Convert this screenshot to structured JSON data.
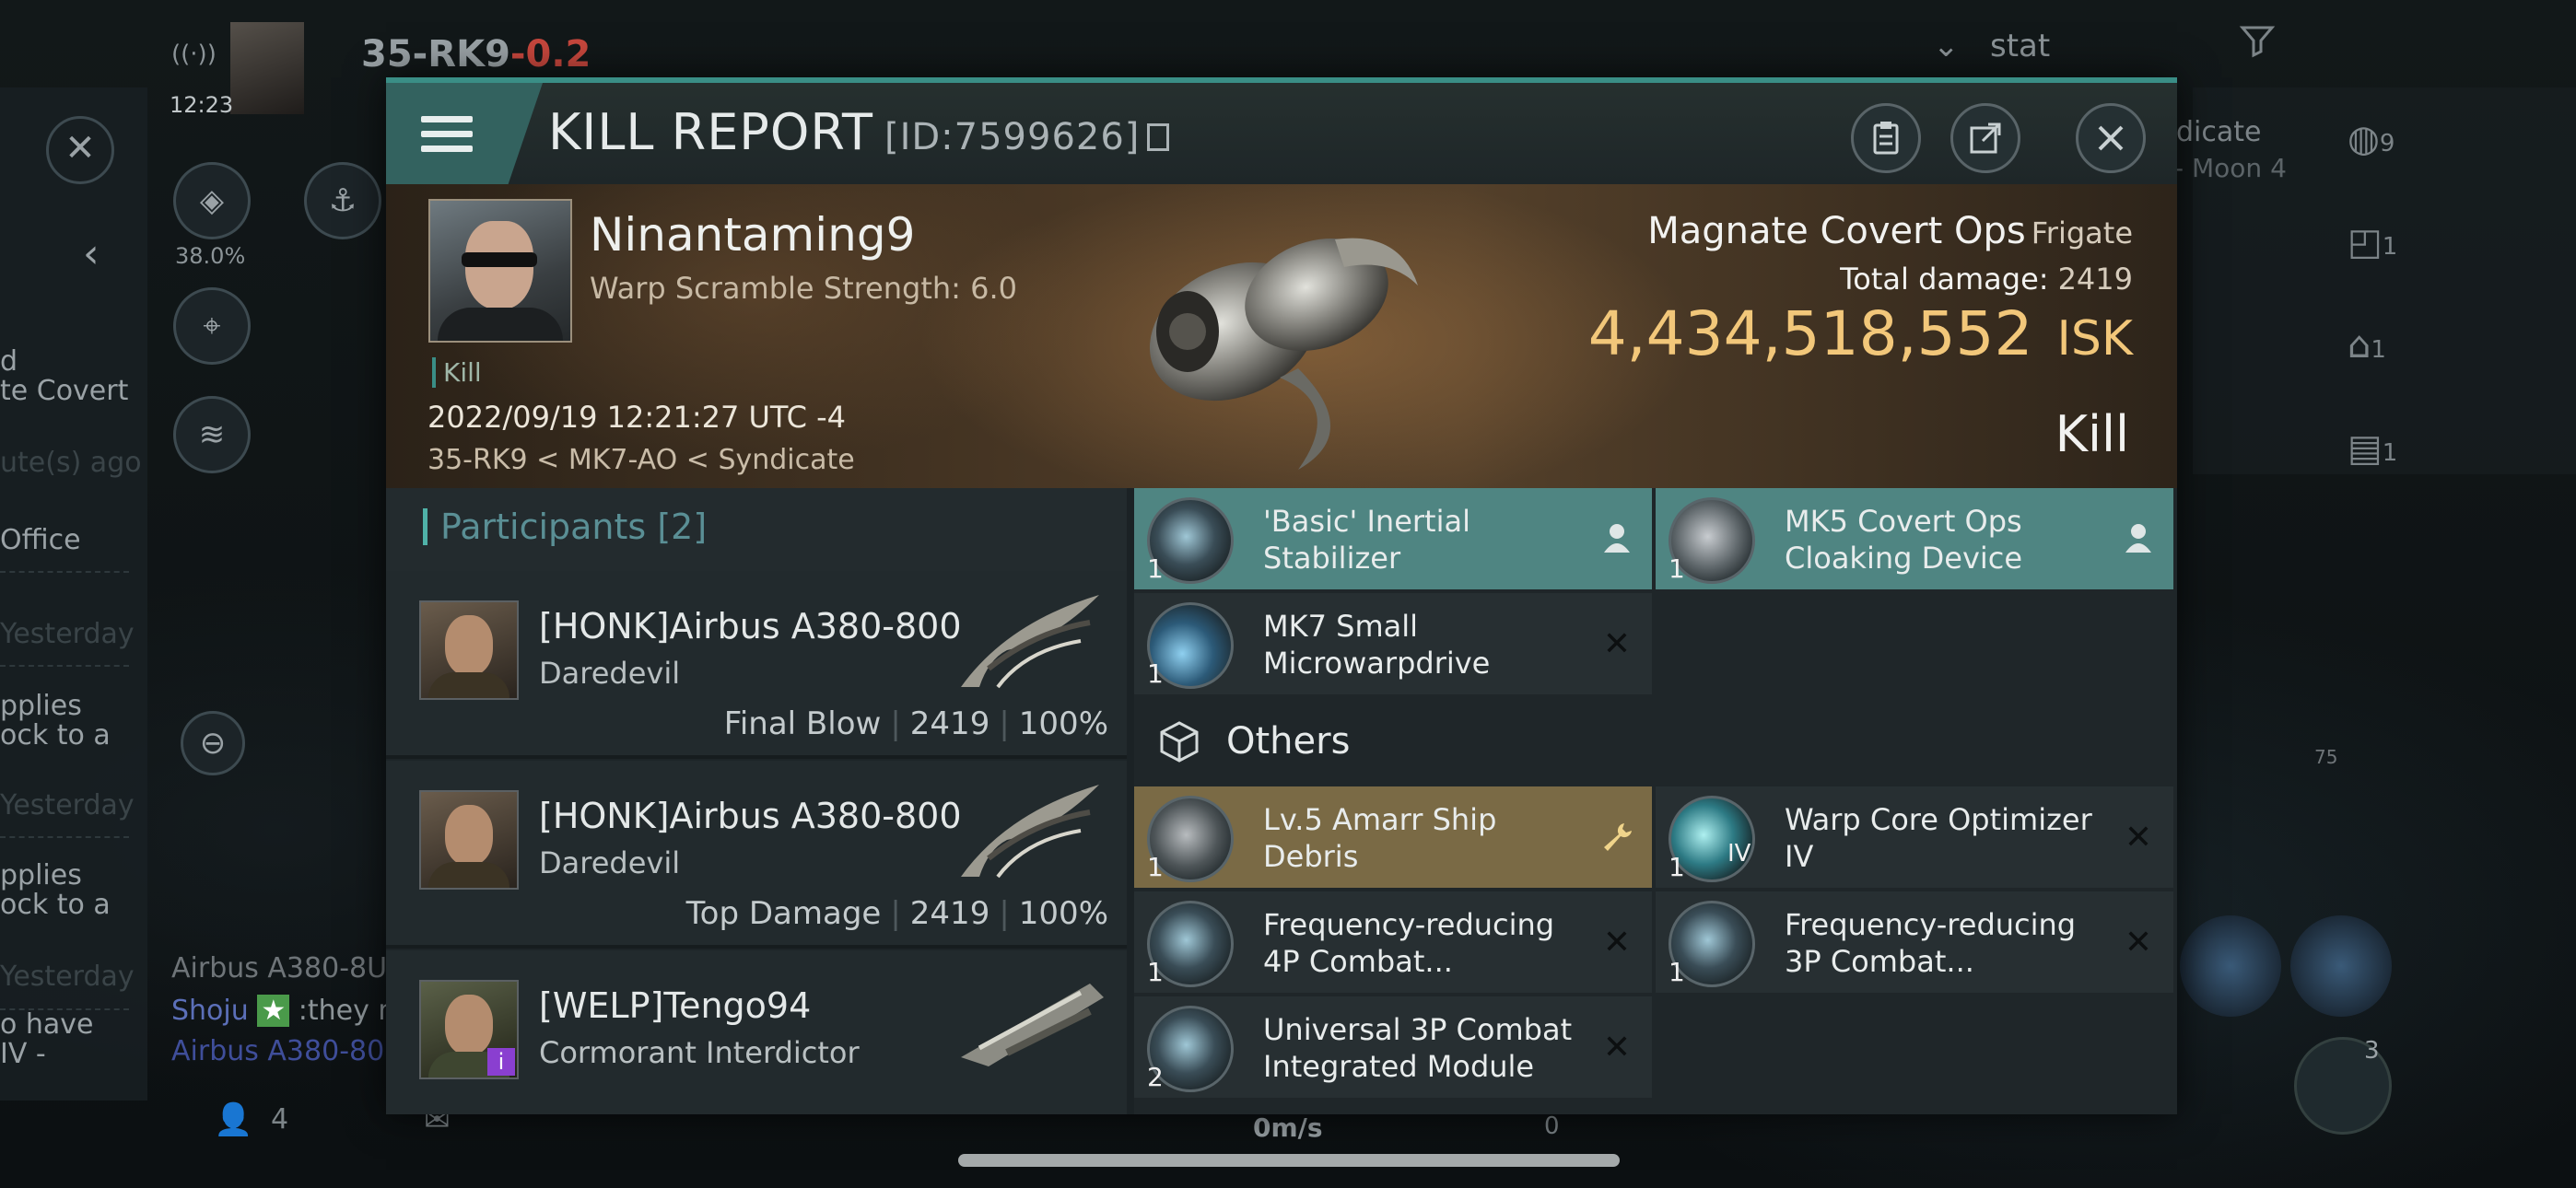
{
  "background": {
    "system_name": "35-RK9",
    "security": "-0.2",
    "clock": "12:23",
    "percent": "38.0%",
    "search_text": "stat",
    "speed": "0m/s",
    "left_panel_texts": [
      "d",
      "te Covert",
      "ute(s) ago",
      "Office",
      "Yesterday",
      "pplies",
      "ock to a",
      "Yesterday",
      "pplies",
      "ock to a",
      "Yesterday",
      "o have",
      "IV -"
    ],
    "chat_name": "Airbus A380-8U",
    "chat_line_user": "Shoju",
    "chat_line_text": ":they n",
    "chat_line_2": "Airbus A380-80",
    "right_panel_text_1": "dicate",
    "right_panel_text_2": "- Moon 4",
    "side_counts": [
      "9",
      "1",
      "1",
      "1"
    ],
    "left_count": "4",
    "zero": "0",
    "nav_count": "3",
    "badge_3": "3",
    "tick_75": "75"
  },
  "modal": {
    "title": "KILL REPORT",
    "report_id": "[ID:7599626]",
    "victim": {
      "name": "Ninantaming9",
      "warp_scramble": "Warp Scramble Strength: 6.0",
      "tag": "Kill",
      "datetime": "2022/09/19 12:21:27 UTC -4",
      "location": "35-RK9 < MK7-AO < Syndicate"
    },
    "ship": {
      "name": "Magnate Covert Ops",
      "class": "Frigate",
      "total_damage_label": "Total damage:",
      "total_damage": "2419",
      "isk_value": "4,434,518,552",
      "isk_unit": "ISK",
      "result": "Kill"
    },
    "participants": {
      "title": "Participants",
      "count": "[2]",
      "rows": [
        {
          "name": "[HONK]Airbus A380-800",
          "ship": "Daredevil",
          "role": "Final Blow",
          "damage": "2419",
          "percent": "100%"
        },
        {
          "name": "[HONK]Airbus A380-800",
          "ship": "Daredevil",
          "role": "Top Damage",
          "damage": "2419",
          "percent": "100%"
        },
        {
          "name": "[WELP]Tengo94",
          "ship": "Cormorant Interdictor",
          "badge": "i"
        }
      ]
    },
    "items": {
      "fitted": [
        {
          "name": "'Basic' Inertial Stabilizer",
          "qty": "1",
          "status": "dropped",
          "icon": "inertial-stabilizer-icon"
        },
        {
          "name": "MK5 Covert Ops Cloaking Device",
          "qty": "1",
          "status": "dropped",
          "icon": "cloaking-device-icon"
        },
        {
          "name": "MK7 Small Microwarpdrive",
          "qty": "1",
          "status": "destroyed",
          "icon": "microwarpdrive-icon"
        }
      ],
      "others_label": "Others",
      "others": [
        {
          "name": "Lv.5 Amarr Ship Debris",
          "qty": "1",
          "status": "salvage",
          "icon": "ship-debris-icon"
        },
        {
          "name": "Warp Core Optimizer IV",
          "qty": "1",
          "tier": "IV",
          "status": "destroyed",
          "icon": "warp-core-icon"
        },
        {
          "name": "Frequency-reducing 4P Combat...",
          "qty": "1",
          "status": "destroyed",
          "icon": "combat-module-icon"
        },
        {
          "name": "Frequency-reducing 3P Combat...",
          "qty": "1",
          "status": "destroyed",
          "icon": "combat-module-icon"
        },
        {
          "name": "Universal 3P Combat Integrated Module",
          "qty": "2",
          "status": "destroyed",
          "icon": "combat-module-icon"
        }
      ]
    }
  }
}
